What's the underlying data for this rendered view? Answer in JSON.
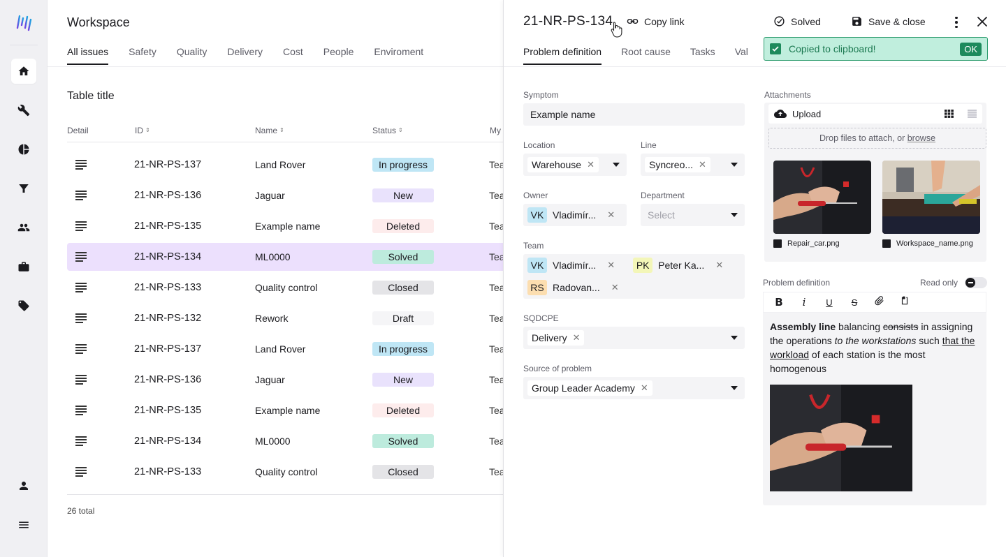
{
  "sidebar": {
    "logo": "app-logo",
    "items": [
      {
        "icon": "home-icon",
        "active": true
      },
      {
        "icon": "wrench-icon"
      },
      {
        "icon": "pie-chart-icon"
      },
      {
        "icon": "filter-icon"
      },
      {
        "icon": "people-icon"
      },
      {
        "icon": "briefcase-icon"
      },
      {
        "icon": "tag-icon"
      }
    ],
    "bottom": [
      {
        "icon": "person-icon"
      },
      {
        "icon": "menu-icon"
      }
    ]
  },
  "main": {
    "title": "Workspace",
    "tabs": [
      "All issues",
      "Safety",
      "Quality",
      "Delivery",
      "Cost",
      "People",
      "Enviroment"
    ],
    "active_tab": "All issues",
    "table": {
      "title": "Table title",
      "columns": [
        "Detail",
        "ID",
        "Name",
        "Status",
        "My"
      ],
      "rows": [
        {
          "id": "21-NR-PS-137",
          "name": "Land Rover",
          "status": "In progress",
          "team": "Tea"
        },
        {
          "id": "21-NR-PS-136",
          "name": "Jaguar",
          "status": "New",
          "team": "Tea"
        },
        {
          "id": "21-NR-PS-135",
          "name": "Example name",
          "status": "Deleted",
          "team": "Tea"
        },
        {
          "id": "21-NR-PS-134",
          "name": "ML0000",
          "status": "Solved",
          "team": "Tea",
          "selected": true
        },
        {
          "id": "21-NR-PS-133",
          "name": "Quality control",
          "status": "Closed",
          "team": "Tea"
        },
        {
          "id": "21-NR-PS-132",
          "name": "Rework",
          "status": "Draft",
          "team": "Tea"
        },
        {
          "id": "21-NR-PS-137",
          "name": "Land Rover",
          "status": "In progress",
          "team": "Tea"
        },
        {
          "id": "21-NR-PS-136",
          "name": "Jaguar",
          "status": "New",
          "team": "Tea"
        },
        {
          "id": "21-NR-PS-135",
          "name": "Example name",
          "status": "Deleted",
          "team": "Tea"
        },
        {
          "id": "21-NR-PS-134",
          "name": "ML0000",
          "status": "Solved",
          "team": "Tea"
        },
        {
          "id": "21-NR-PS-133",
          "name": "Quality control",
          "status": "Closed",
          "team": "Tea"
        }
      ],
      "total": "26 total"
    }
  },
  "drawer": {
    "title": "21-NR-PS-134",
    "copy_link": "Copy link",
    "solved": "Solved",
    "save_close": "Save & close",
    "tabs": [
      "Problem definition",
      "Root cause",
      "Tasks",
      "Val"
    ],
    "toast": {
      "message": "Copied to clipboard!",
      "ok": "OK",
      "color": "#1d8a5c"
    },
    "form": {
      "symptom": {
        "label": "Symptom",
        "value": "Example name"
      },
      "location": {
        "label": "Location",
        "value": "Warehouse"
      },
      "line": {
        "label": "Line",
        "value": "Syncreo..."
      },
      "owner": {
        "label": "Owner",
        "initials": "VK",
        "name": "Vladimír..."
      },
      "department": {
        "label": "Department",
        "placeholder": "Select"
      },
      "team": {
        "label": "Team",
        "members": [
          {
            "initials": "VK",
            "name": "Vladimír..."
          },
          {
            "initials": "PK",
            "name": "Peter Ka..."
          },
          {
            "initials": "RS",
            "name": "Radovan..."
          }
        ]
      },
      "sqdcpe": {
        "label": "SQDCPE",
        "value": "Delivery"
      },
      "source": {
        "label": "Source of problem",
        "value": "Group Leader Academy"
      }
    },
    "attachments": {
      "label": "Attachments",
      "upload": "Upload",
      "drop_text": "Drop files to attach, or ",
      "browse": "browse",
      "files": [
        "Repair_car.png",
        "Workspace_name.png"
      ]
    },
    "problem_definition": {
      "label": "Problem definition",
      "read_only": "Read only",
      "toolbar": [
        "B",
        "i",
        "U",
        "S",
        "attach",
        "clipboard"
      ],
      "text": {
        "bold": "Assembly line",
        "t1": " balancing ",
        "strike": "consists",
        "t2": " in assigning the operations ",
        "italic": "to the workstations",
        "t3": " such ",
        "underline": "that the workload",
        "t4": " of each station is the most homogenous"
      }
    }
  }
}
